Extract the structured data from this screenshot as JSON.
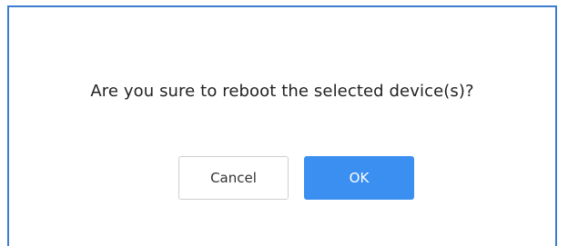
{
  "dialog": {
    "message": "Are you sure to reboot the selected device(s)?",
    "cancel_label": "Cancel",
    "ok_label": "OK"
  },
  "colors": {
    "accent": "#3a8ff0",
    "border": "#3d7ccc"
  }
}
